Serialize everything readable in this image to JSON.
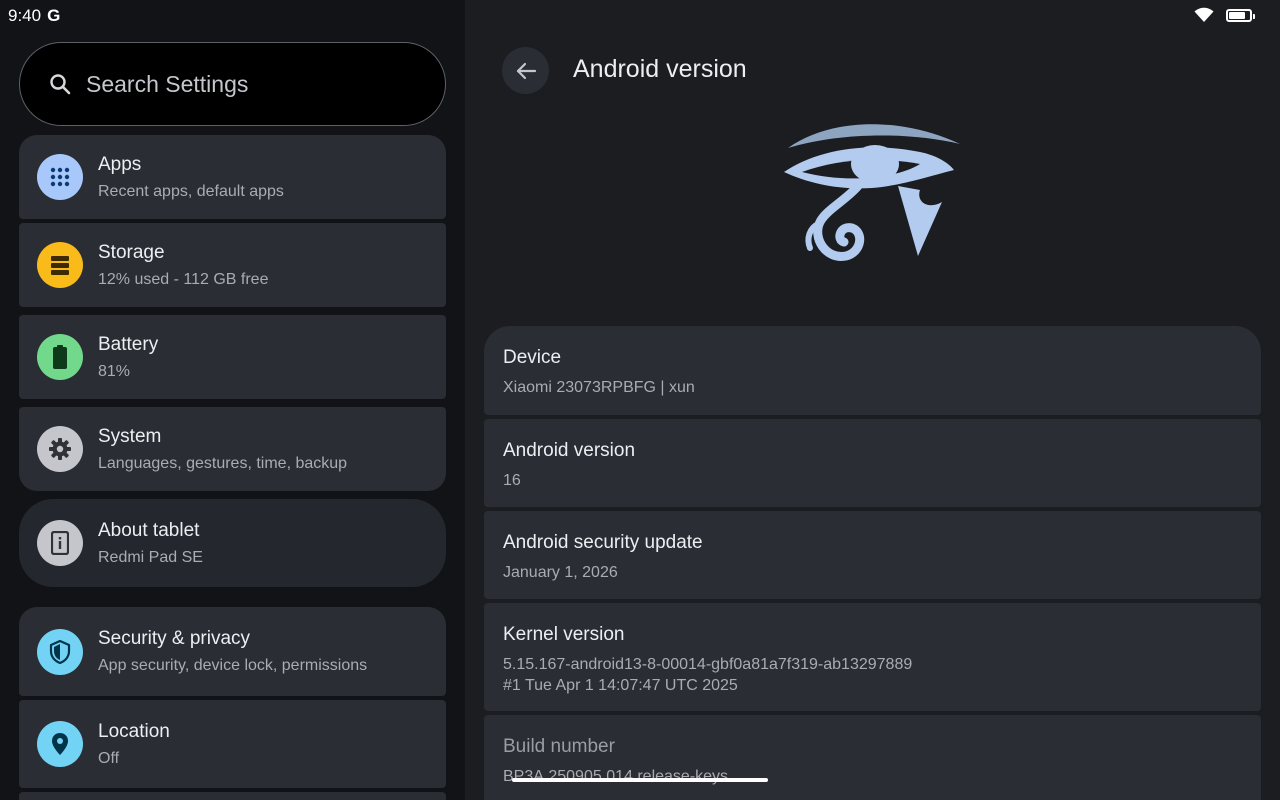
{
  "status_bar": {
    "time": "9:40",
    "g_label": "G"
  },
  "search": {
    "placeholder": "Search Settings"
  },
  "settings_list": [
    {
      "title": "Apps",
      "subtitle": "Recent apps, default apps",
      "icon": "apps-grid-icon",
      "color": "#a8c7fa"
    },
    {
      "title": "Storage",
      "subtitle": "12% used - 112 GB free",
      "icon": "storage-icon",
      "color": "#f9bb1a"
    },
    {
      "title": "Battery",
      "subtitle": "81%",
      "icon": "battery-icon",
      "color": "#72d98c"
    },
    {
      "title": "System",
      "subtitle": "Languages, gestures, time, backup",
      "icon": "gear-icon",
      "color": "#c4c6cb"
    },
    {
      "title": "About tablet",
      "subtitle": "Redmi Pad SE",
      "icon": "tablet-info-icon",
      "color": "#c4c6cb"
    },
    {
      "title": "Security & privacy",
      "subtitle": "App security, device lock, permissions",
      "icon": "shield-icon",
      "color": "#73d3f5"
    },
    {
      "title": "Location",
      "subtitle": "Off",
      "icon": "location-pin-icon",
      "color": "#73d3f5"
    }
  ],
  "detail": {
    "title": "Android version",
    "logo_icon": "eye-of-horus-icon",
    "rows": [
      {
        "label": "Device",
        "value": "Xiaomi 23073RPBFG | xun"
      },
      {
        "label": "Android version",
        "value": "16"
      },
      {
        "label": "Android security update",
        "value": "January 1, 2026"
      },
      {
        "label": "Kernel version",
        "value": "5.15.167-android13-8-00014-gbf0a81a7f319-ab13297889\n#1 Tue Apr 1 14:07:47 UTC 2025"
      },
      {
        "label": "Build number",
        "value": "BP3A.250905.014 release-keys"
      }
    ]
  },
  "battery_level": 0.81
}
